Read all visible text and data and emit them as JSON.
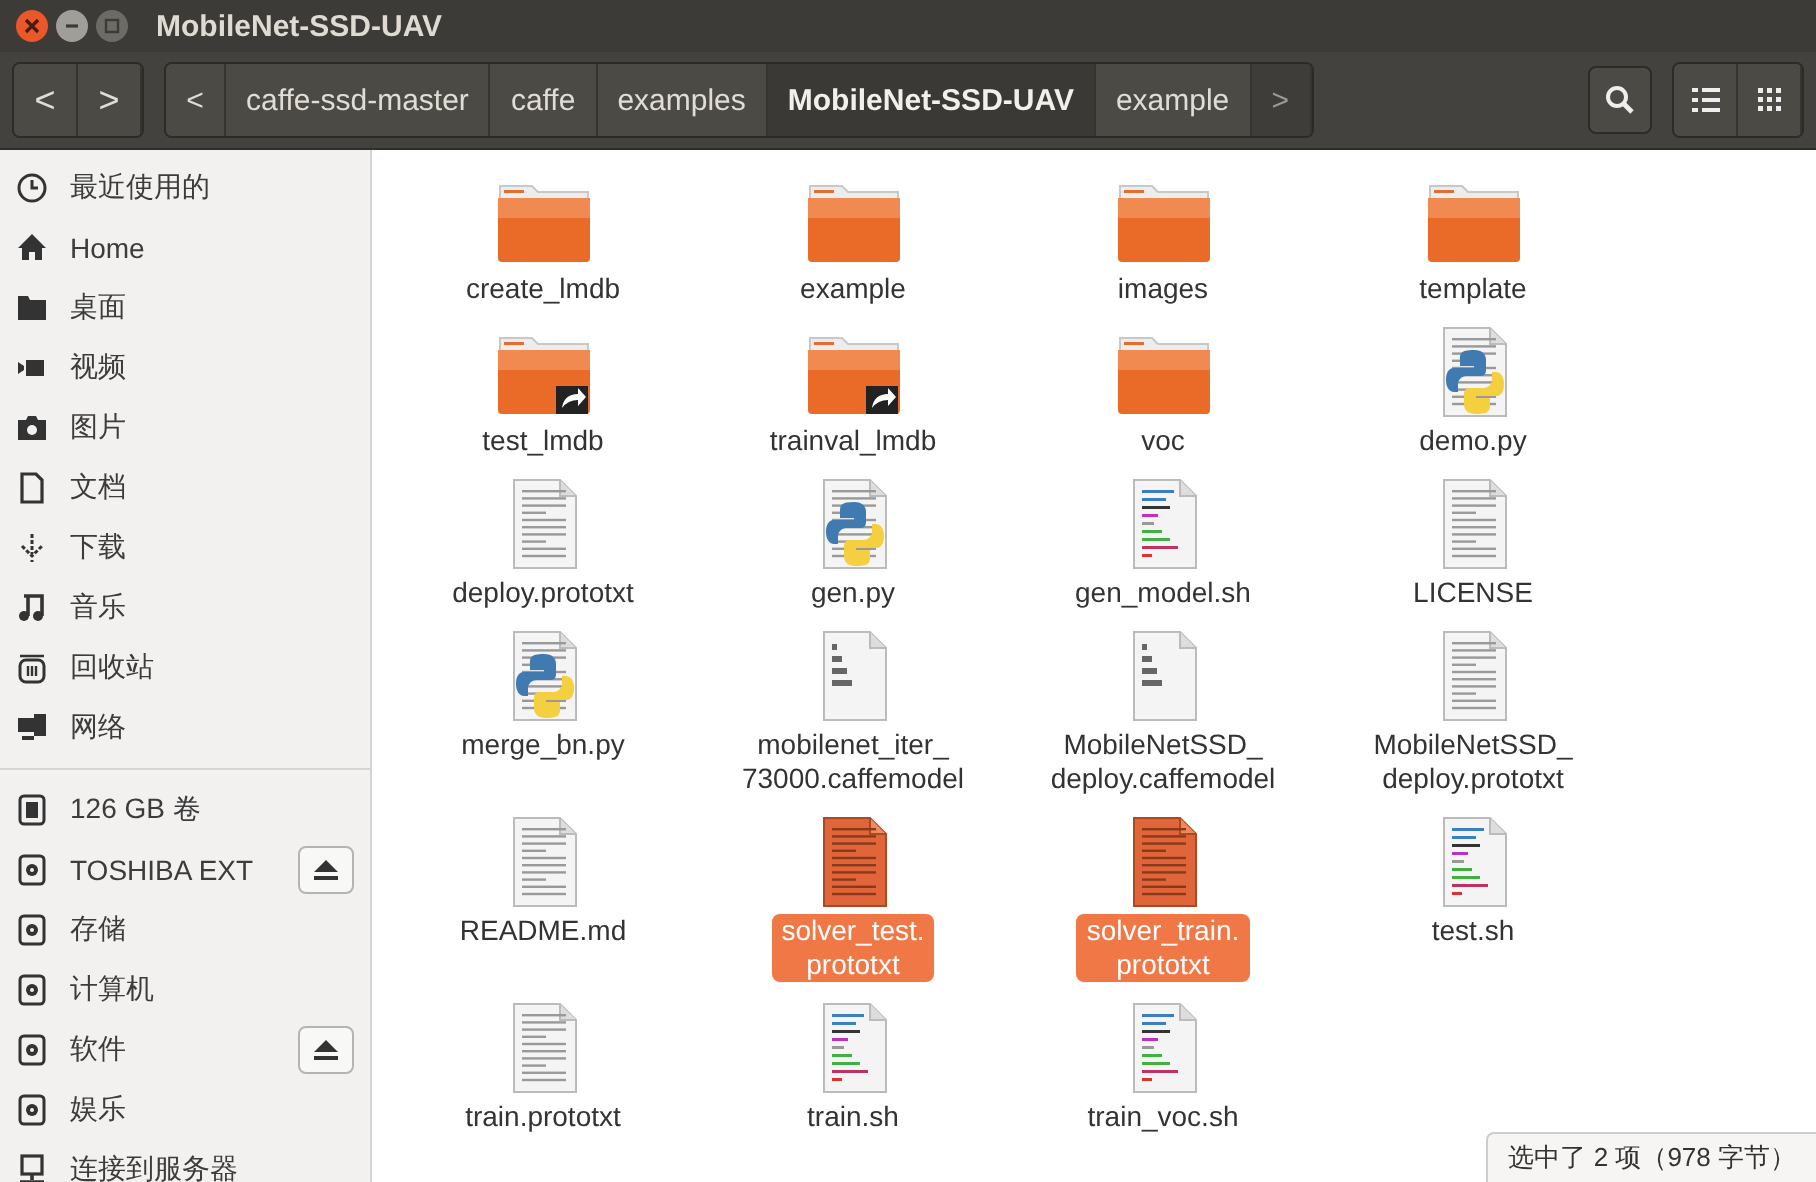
{
  "window": {
    "title": "MobileNet-SSD-UAV"
  },
  "toolbar": {
    "back": "<",
    "forward": ">",
    "path_left": "<",
    "path_right": ">",
    "path": [
      {
        "label": "caffe-ssd-master",
        "selected": false
      },
      {
        "label": "caffe",
        "selected": false
      },
      {
        "label": "examples",
        "selected": false
      },
      {
        "label": "MobileNet-SSD-UAV",
        "selected": true
      },
      {
        "label": "example",
        "selected": false
      }
    ]
  },
  "sidebar": {
    "places": [
      {
        "label": "最近使用的"
      },
      {
        "label": "Home"
      },
      {
        "label": "桌面"
      },
      {
        "label": "视频"
      },
      {
        "label": "图片"
      },
      {
        "label": "文档"
      },
      {
        "label": "下载"
      },
      {
        "label": "音乐"
      },
      {
        "label": "回收站"
      },
      {
        "label": "网络"
      }
    ],
    "devices": [
      {
        "label": "126 GB 卷",
        "eject": false
      },
      {
        "label": "TOSHIBA EXT",
        "eject": true
      },
      {
        "label": "存储",
        "eject": false
      },
      {
        "label": "计算机",
        "eject": false
      },
      {
        "label": "软件",
        "eject": true
      },
      {
        "label": "娱乐",
        "eject": false
      },
      {
        "label": "连接到服务器",
        "eject": false
      }
    ]
  },
  "files": [
    {
      "kind": "folder",
      "label": "create_lmdb",
      "selected": false
    },
    {
      "kind": "folder",
      "label": "example",
      "selected": false
    },
    {
      "kind": "folder",
      "label": "images",
      "selected": false
    },
    {
      "kind": "folder",
      "label": "template",
      "selected": false
    },
    {
      "kind": "folder-link",
      "label": "test_lmdb",
      "selected": false
    },
    {
      "kind": "folder-link",
      "label": "trainval_lmdb",
      "selected": false
    },
    {
      "kind": "folder",
      "label": "voc",
      "selected": false
    },
    {
      "kind": "python",
      "label": "demo.py",
      "selected": false
    },
    {
      "kind": "text",
      "label": "deploy.prototxt",
      "selected": false
    },
    {
      "kind": "python",
      "label": "gen.py",
      "selected": false
    },
    {
      "kind": "script",
      "label": "gen_model.sh",
      "selected": false
    },
    {
      "kind": "text",
      "label": "LICENSE",
      "selected": false
    },
    {
      "kind": "python",
      "label": "merge_bn.py",
      "selected": false
    },
    {
      "kind": "binary",
      "label": "mobilenet_iter_\n73000.caffemodel",
      "selected": false
    },
    {
      "kind": "binary",
      "label": "MobileNetSSD_\ndeploy.caffemodel",
      "selected": false
    },
    {
      "kind": "text",
      "label": "MobileNetSSD_\ndeploy.prototxt",
      "selected": false
    },
    {
      "kind": "text",
      "label": "README.md",
      "selected": false
    },
    {
      "kind": "text",
      "label": "solver_test.\nprototxt",
      "selected": true
    },
    {
      "kind": "text",
      "label": "solver_train.\nprototxt",
      "selected": true
    },
    {
      "kind": "script",
      "label": "test.sh",
      "selected": false
    },
    {
      "kind": "text",
      "label": "train.prototxt",
      "selected": false
    },
    {
      "kind": "script",
      "label": "train.sh",
      "selected": false
    },
    {
      "kind": "script",
      "label": "train_voc.sh",
      "selected": false
    }
  ],
  "status": "选中了 2 项（978 字节）"
}
